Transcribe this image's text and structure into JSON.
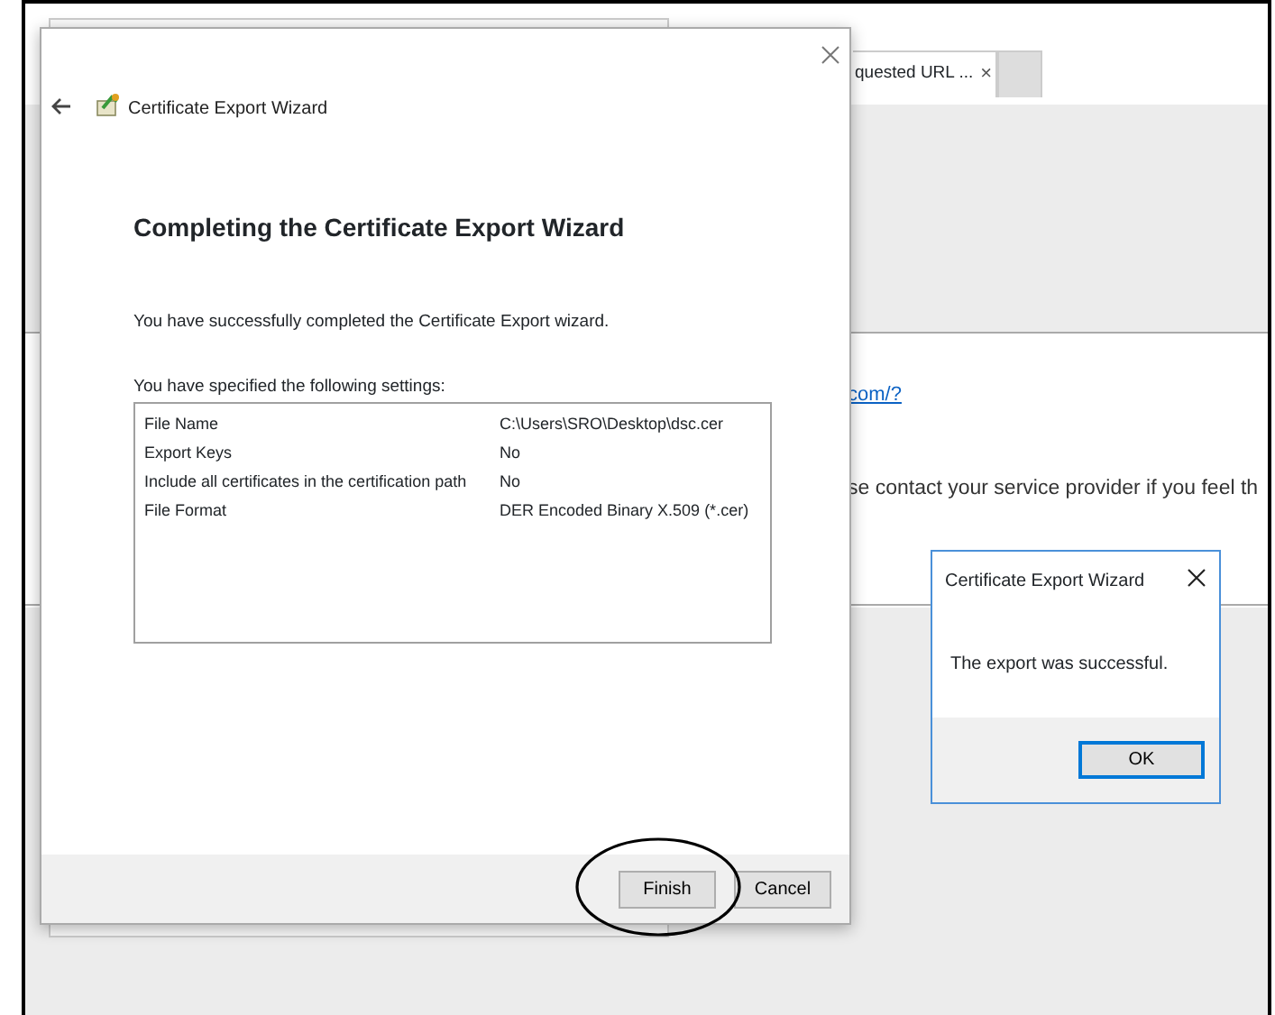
{
  "browser": {
    "tab": {
      "label": "quested URL ...",
      "close": "×"
    },
    "link": "com/?",
    "text": "se contact your service provider if you feel th"
  },
  "wizard": {
    "title": "Certificate Export Wizard",
    "heading": "Completing the Certificate Export Wizard",
    "message": "You have successfully completed the Certificate Export wizard.",
    "settings_label": "You have specified the following settings:",
    "settings": [
      {
        "name": "File Name",
        "value": "C:\\Users\\SRO\\Desktop\\dsc.cer"
      },
      {
        "name": "Export Keys",
        "value": "No"
      },
      {
        "name": "Include all certificates in the certification path",
        "value": "No"
      },
      {
        "name": "File Format",
        "value": "DER Encoded Binary X.509 (*.cer)"
      }
    ],
    "buttons": [
      {
        "label": "Finish",
        "default": false,
        "circled": true
      },
      {
        "label": "Cancel",
        "default": false,
        "circled": false
      }
    ]
  },
  "message_box": {
    "title": "Certificate Export Wizard",
    "message": "The export was successful.",
    "buttons": [
      {
        "label": "OK",
        "default": true
      }
    ]
  }
}
